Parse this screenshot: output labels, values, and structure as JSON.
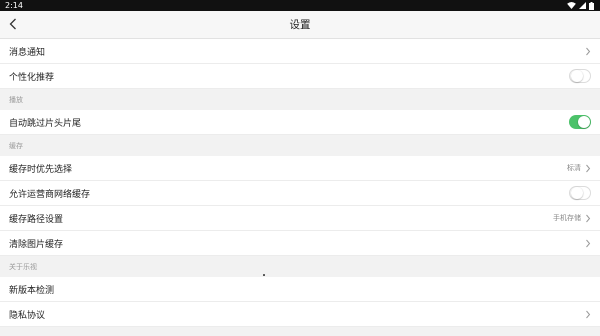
{
  "status_bar": {
    "time": "2:14"
  },
  "header": {
    "title": "设置",
    "back_icon": "chevron-left-icon"
  },
  "rows": {
    "notifications": {
      "label": "消息通知"
    },
    "personalized": {
      "label": "个性化推荐",
      "toggle_on": false
    },
    "auto_skip": {
      "label": "自动跳过片头片尾",
      "toggle_on": true
    },
    "cache_priority": {
      "label": "缓存时优先选择",
      "value": "标清"
    },
    "carrier_cache": {
      "label": "允许运营商网络缓存",
      "toggle_on": false
    },
    "cache_path": {
      "label": "缓存路径设置",
      "value": "手机存储"
    },
    "clear_images": {
      "label": "清除图片缓存"
    },
    "check_update": {
      "label": "新版本检测"
    },
    "privacy": {
      "label": "隐私协议"
    }
  },
  "sections": {
    "playback": "播放",
    "cache": "缓存",
    "about": "关于乐视"
  },
  "colors": {
    "toggle_on": "#4cc26a",
    "background": "#f2f2f2"
  }
}
